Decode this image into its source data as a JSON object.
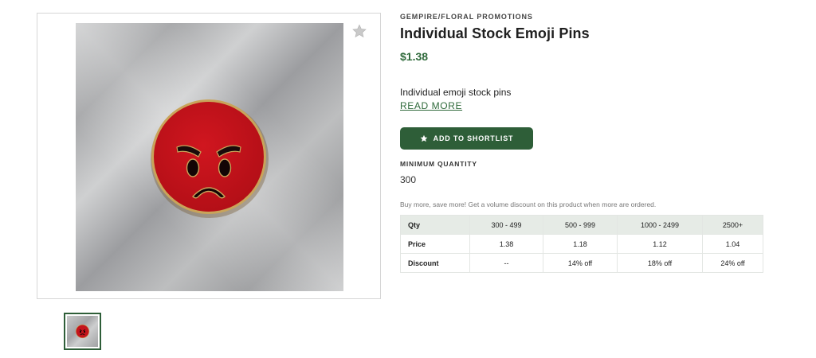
{
  "product": {
    "brand": "GEMPIRE/FLORAL PROMOTIONS",
    "title": "Individual Stock Emoji Pins",
    "price": "$1.38",
    "description": "Individual emoji stock pins",
    "read_more_label": "READ MORE",
    "shortlist_label": "ADD TO SHORTLIST",
    "min_quantity_label": "MINIMUM QUANTITY",
    "min_quantity_value": "300",
    "volume_note": "Buy more, save more! Get a volume discount on this product when more are ordered."
  },
  "pricing_table": {
    "header": [
      "Qty",
      "300 - 499",
      "500 - 999",
      "1000 - 2499",
      "2500+"
    ],
    "rows": [
      [
        "Price",
        "1.38",
        "1.18",
        "1.12",
        "1.04"
      ],
      [
        "Discount",
        "--",
        "14% off",
        "18% off",
        "24% off"
      ]
    ]
  },
  "icons": {
    "favorite": "star-icon",
    "shortlist": "star-icon",
    "product_image": "angry-emoji-pin"
  },
  "colors": {
    "brand_green": "#2e5e38",
    "price_green": "#2f6a3b",
    "pin_red": "#c4141c",
    "table_header_bg": "#e6ebe6"
  }
}
